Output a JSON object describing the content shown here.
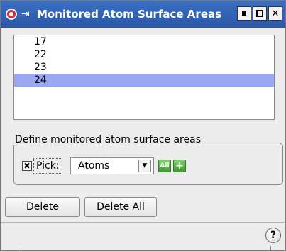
{
  "window": {
    "title": "Monitored Atom Surface Areas",
    "pin_glyph": "⇥",
    "close_glyph": "✕"
  },
  "atom_list": {
    "items": [
      "17",
      "22",
      "23",
      "24"
    ],
    "selected_index": 3
  },
  "define_group": {
    "title": "Define monitored atom surface areas",
    "pick_label": "Pick:",
    "pick_checked": true,
    "pick_mark": "✖",
    "select_value": "Atoms",
    "all_label": "All",
    "add_label": "+"
  },
  "actions": {
    "delete_label": "Delete",
    "delete_all_label": "Delete All"
  },
  "help": {
    "label": "?"
  },
  "colors": {
    "titlebar": "#2b58a6",
    "selection": "#9aa6f0",
    "green_button": "#3f9a33"
  }
}
